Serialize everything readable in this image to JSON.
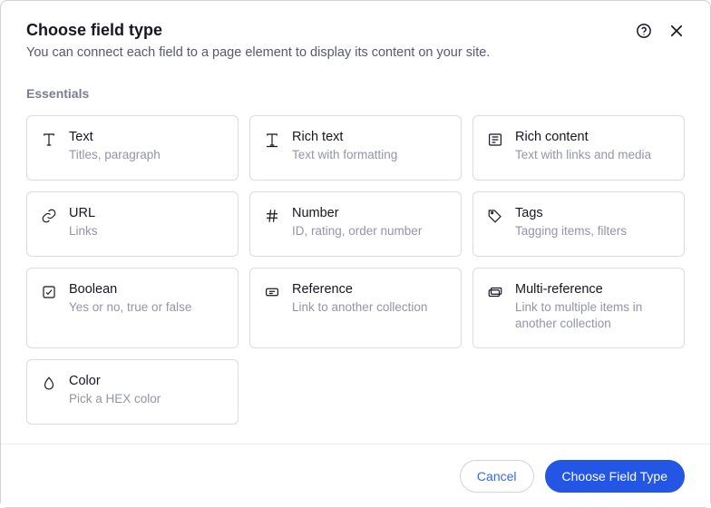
{
  "header": {
    "title": "Choose field type",
    "subtitle": "You can connect each field to a page element to display its content on your site."
  },
  "section": {
    "label": "Essentials"
  },
  "fields": [
    {
      "icon": "text-icon",
      "title": "Text",
      "desc": "Titles, paragraph"
    },
    {
      "icon": "rich-text-icon",
      "title": "Rich text",
      "desc": "Text with formatting"
    },
    {
      "icon": "rich-content-icon",
      "title": "Rich content",
      "desc": "Text with links and media"
    },
    {
      "icon": "url-icon",
      "title": "URL",
      "desc": "Links"
    },
    {
      "icon": "number-icon",
      "title": "Number",
      "desc": "ID, rating, order number"
    },
    {
      "icon": "tags-icon",
      "title": "Tags",
      "desc": "Tagging items, filters"
    },
    {
      "icon": "boolean-icon",
      "title": "Boolean",
      "desc": "Yes or no, true or false"
    },
    {
      "icon": "reference-icon",
      "title": "Reference",
      "desc": "Link to another collection"
    },
    {
      "icon": "multi-reference-icon",
      "title": "Multi-reference",
      "desc": "Link to multiple items in another collection"
    },
    {
      "icon": "color-icon",
      "title": "Color",
      "desc": "Pick a HEX color"
    }
  ],
  "footer": {
    "cancel": "Cancel",
    "confirm": "Choose Field Type"
  }
}
